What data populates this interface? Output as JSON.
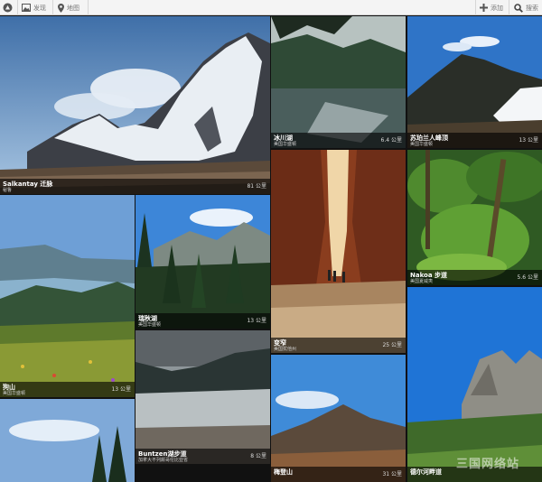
{
  "topbar": {
    "discover_label": "发现",
    "explore_label": "地图",
    "add_label": "添加",
    "search_label": "搜索"
  },
  "tiles": {
    "salkantay": {
      "name": "Salkantay 迁脉",
      "sub": "秘鲁",
      "dist": "81 公里"
    },
    "icecave": {
      "name": "冰川湖",
      "sub": "美国华盛顿",
      "dist": "6.4 公里"
    },
    "sisters": {
      "name": "苏珀兰人峰顶",
      "sub": "美国华盛顿",
      "dist": "13 公里"
    },
    "mountain_gorge": {
      "name": "狗山",
      "sub": "美国华盛顿",
      "dist": "13 公里"
    },
    "lake_trail": {
      "name": "瑞秋湖",
      "sub": "美国华盛顿",
      "dist": "13 公里"
    },
    "narrows": {
      "name": "变窄",
      "sub": "美国犹他州",
      "dist": "25 公里"
    },
    "nakoa": {
      "name": "Nakoa 步道",
      "sub": "美国夏威夷",
      "dist": "5.6 公里"
    },
    "buntzen": {
      "name": "Buntzen湖步道",
      "sub": "加拿大不列颠哥伦比亚省",
      "dist": "8 公里"
    },
    "half_dome": {
      "name": "梅登山",
      "sub": "",
      "dist": "31 公里"
    },
    "rock_peak": {
      "name": "德尔河畔道",
      "sub": "",
      "dist": ""
    }
  },
  "watermark": "三国网络站"
}
